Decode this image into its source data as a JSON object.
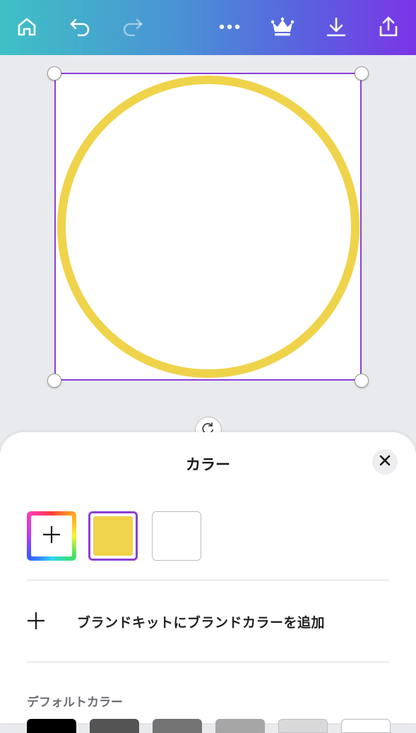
{
  "toolbar": {
    "icons": [
      "home-icon",
      "undo-icon",
      "redo-icon",
      "more-icon",
      "crown-icon",
      "download-icon",
      "share-icon"
    ]
  },
  "canvas": {
    "page_color": "#ffffff",
    "circle_stroke_color": "#efd34a",
    "selection_color": "#8b3fd9"
  },
  "color_panel": {
    "title": "カラー",
    "close_label": "✕",
    "document_colors": [
      "#efd34a",
      "#ffffff"
    ],
    "selected_color": "#efd34a",
    "add_brand_label": "ブランドキットにブランドカラーを追加",
    "default_colors_label": "デフォルトカラー",
    "default_colors": [
      "#000000",
      "#545454",
      "#737373",
      "#a6a6a6",
      "#d9d9d9",
      "#ffffff"
    ]
  }
}
